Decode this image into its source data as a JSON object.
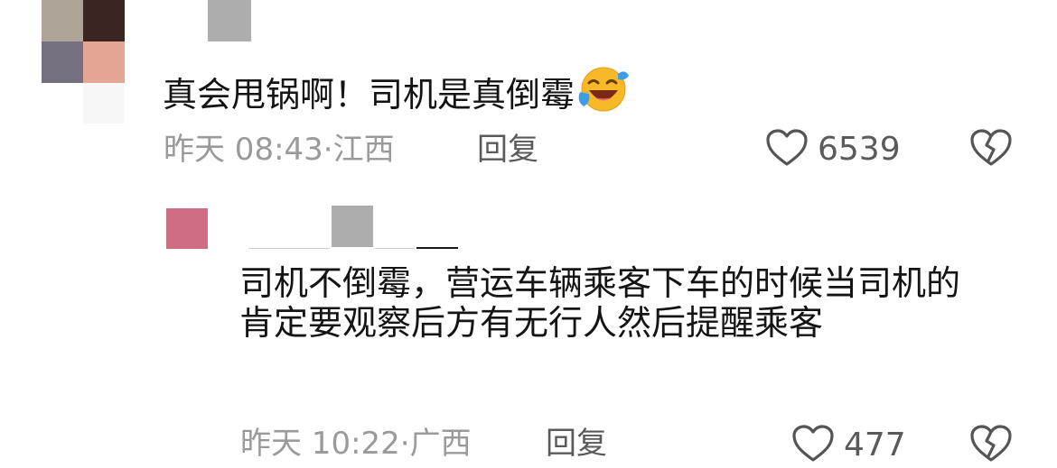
{
  "comment": {
    "text": "真会甩锅啊！司机是真倒霉",
    "emoji": "grinning-with-tears-emoji",
    "time": "昨天 08:43",
    "sep": "·",
    "location": "江西",
    "reply_label": "回复",
    "likes": "6539"
  },
  "reply": {
    "text": "司机不倒霉，营运车辆乘客下车的时候当司机的肯定要观察后方有无行人然后提醒乘客",
    "time": "昨天 10:22",
    "sep": "·",
    "location": "广西",
    "reply_label": "回复",
    "likes": "477"
  },
  "colors": {
    "muted": "#9a9a9a",
    "action": "#5a5a5a",
    "text": "#141414",
    "emoji_yellow": "#f7b928",
    "tear_blue": "#3c9ee8"
  },
  "icons": {
    "like": "heart-outline-icon",
    "dislike": "broken-heart-outline-icon"
  }
}
